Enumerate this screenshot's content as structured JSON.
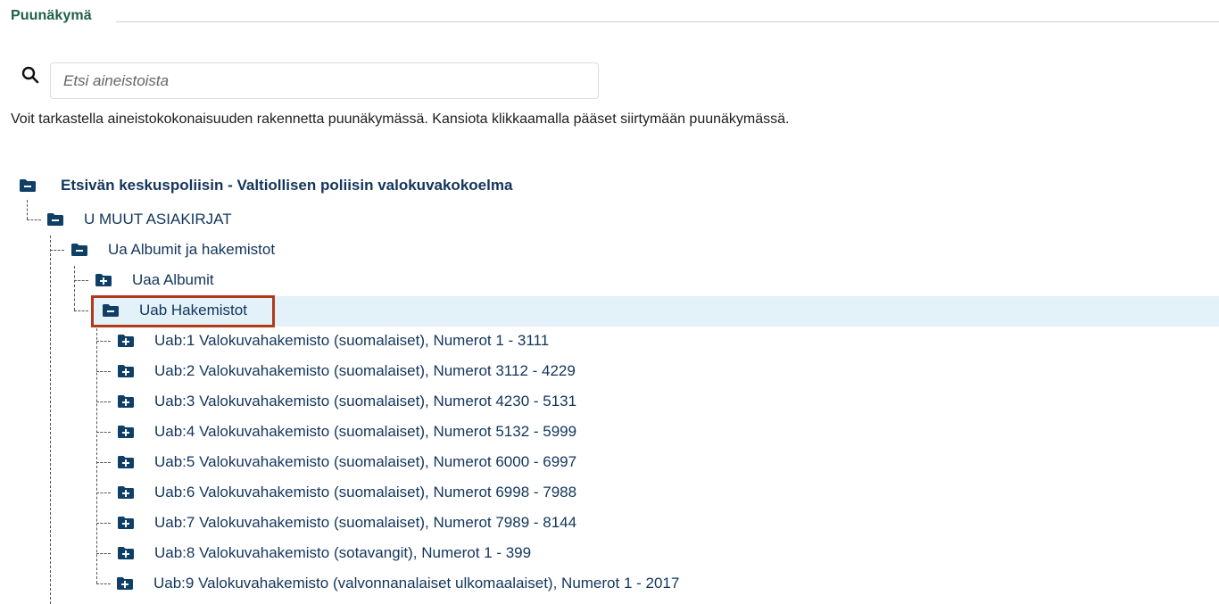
{
  "section": {
    "title": "Puunäkymä"
  },
  "search": {
    "placeholder": "Etsi aineistoista",
    "value": ""
  },
  "description": "Voit tarkastella aineistokokonaisuuden rakennetta puunäkymässä. Kansiota klikkaamalla pääset siirtymään puunäkymässä.",
  "tree": {
    "root": {
      "label": "Etsivän keskuspoliisin - Valtiollisen poliisin valokuvakokoelma",
      "icon": "folder-minus-icon"
    },
    "level1": {
      "label": "U MUUT ASIAKIRJAT",
      "icon": "folder-minus-icon"
    },
    "level2": {
      "label": "Ua Albumit ja hakemistot",
      "icon": "folder-minus-icon"
    },
    "level3": [
      {
        "label": "Uaa Albumit",
        "icon": "folder-plus-icon"
      },
      {
        "label": "Uab Hakemistot",
        "icon": "folder-minus-icon",
        "selected": true
      }
    ],
    "level4": [
      {
        "label": "Uab:1 Valokuvahakemisto (suomalaiset), Numerot 1 - 3111",
        "icon": "folder-plus-icon"
      },
      {
        "label": "Uab:2 Valokuvahakemisto (suomalaiset), Numerot 3112 - 4229",
        "icon": "folder-plus-icon"
      },
      {
        "label": "Uab:3 Valokuvahakemisto (suomalaiset), Numerot 4230 - 5131",
        "icon": "folder-plus-icon"
      },
      {
        "label": "Uab:4 Valokuvahakemisto (suomalaiset), Numerot 5132 - 5999",
        "icon": "folder-plus-icon"
      },
      {
        "label": "Uab:5 Valokuvahakemisto (suomalaiset), Numerot 6000 - 6997",
        "icon": "folder-plus-icon"
      },
      {
        "label": "Uab:6 Valokuvahakemisto (suomalaiset), Numerot 6998 - 7988",
        "icon": "folder-plus-icon"
      },
      {
        "label": "Uab:7 Valokuvahakemisto (suomalaiset), Numerot 7989 - 8144",
        "icon": "folder-plus-icon"
      },
      {
        "label": "Uab:8 Valokuvahakemisto (sotavangit), Numerot 1 - 399",
        "icon": "folder-plus-icon"
      },
      {
        "label": "Uab:9 Valokuvahakemisto (valvonnanalaiset ulkomaalaiset), Numerot 1 - 2017",
        "icon": "folder-plus-icon"
      }
    ]
  },
  "colors": {
    "title": "#1d5e4a",
    "folder": "#0f3f66",
    "link": "#12355b",
    "selected_bg": "#e3f1f8",
    "highlight_border": "#b23a1a"
  }
}
